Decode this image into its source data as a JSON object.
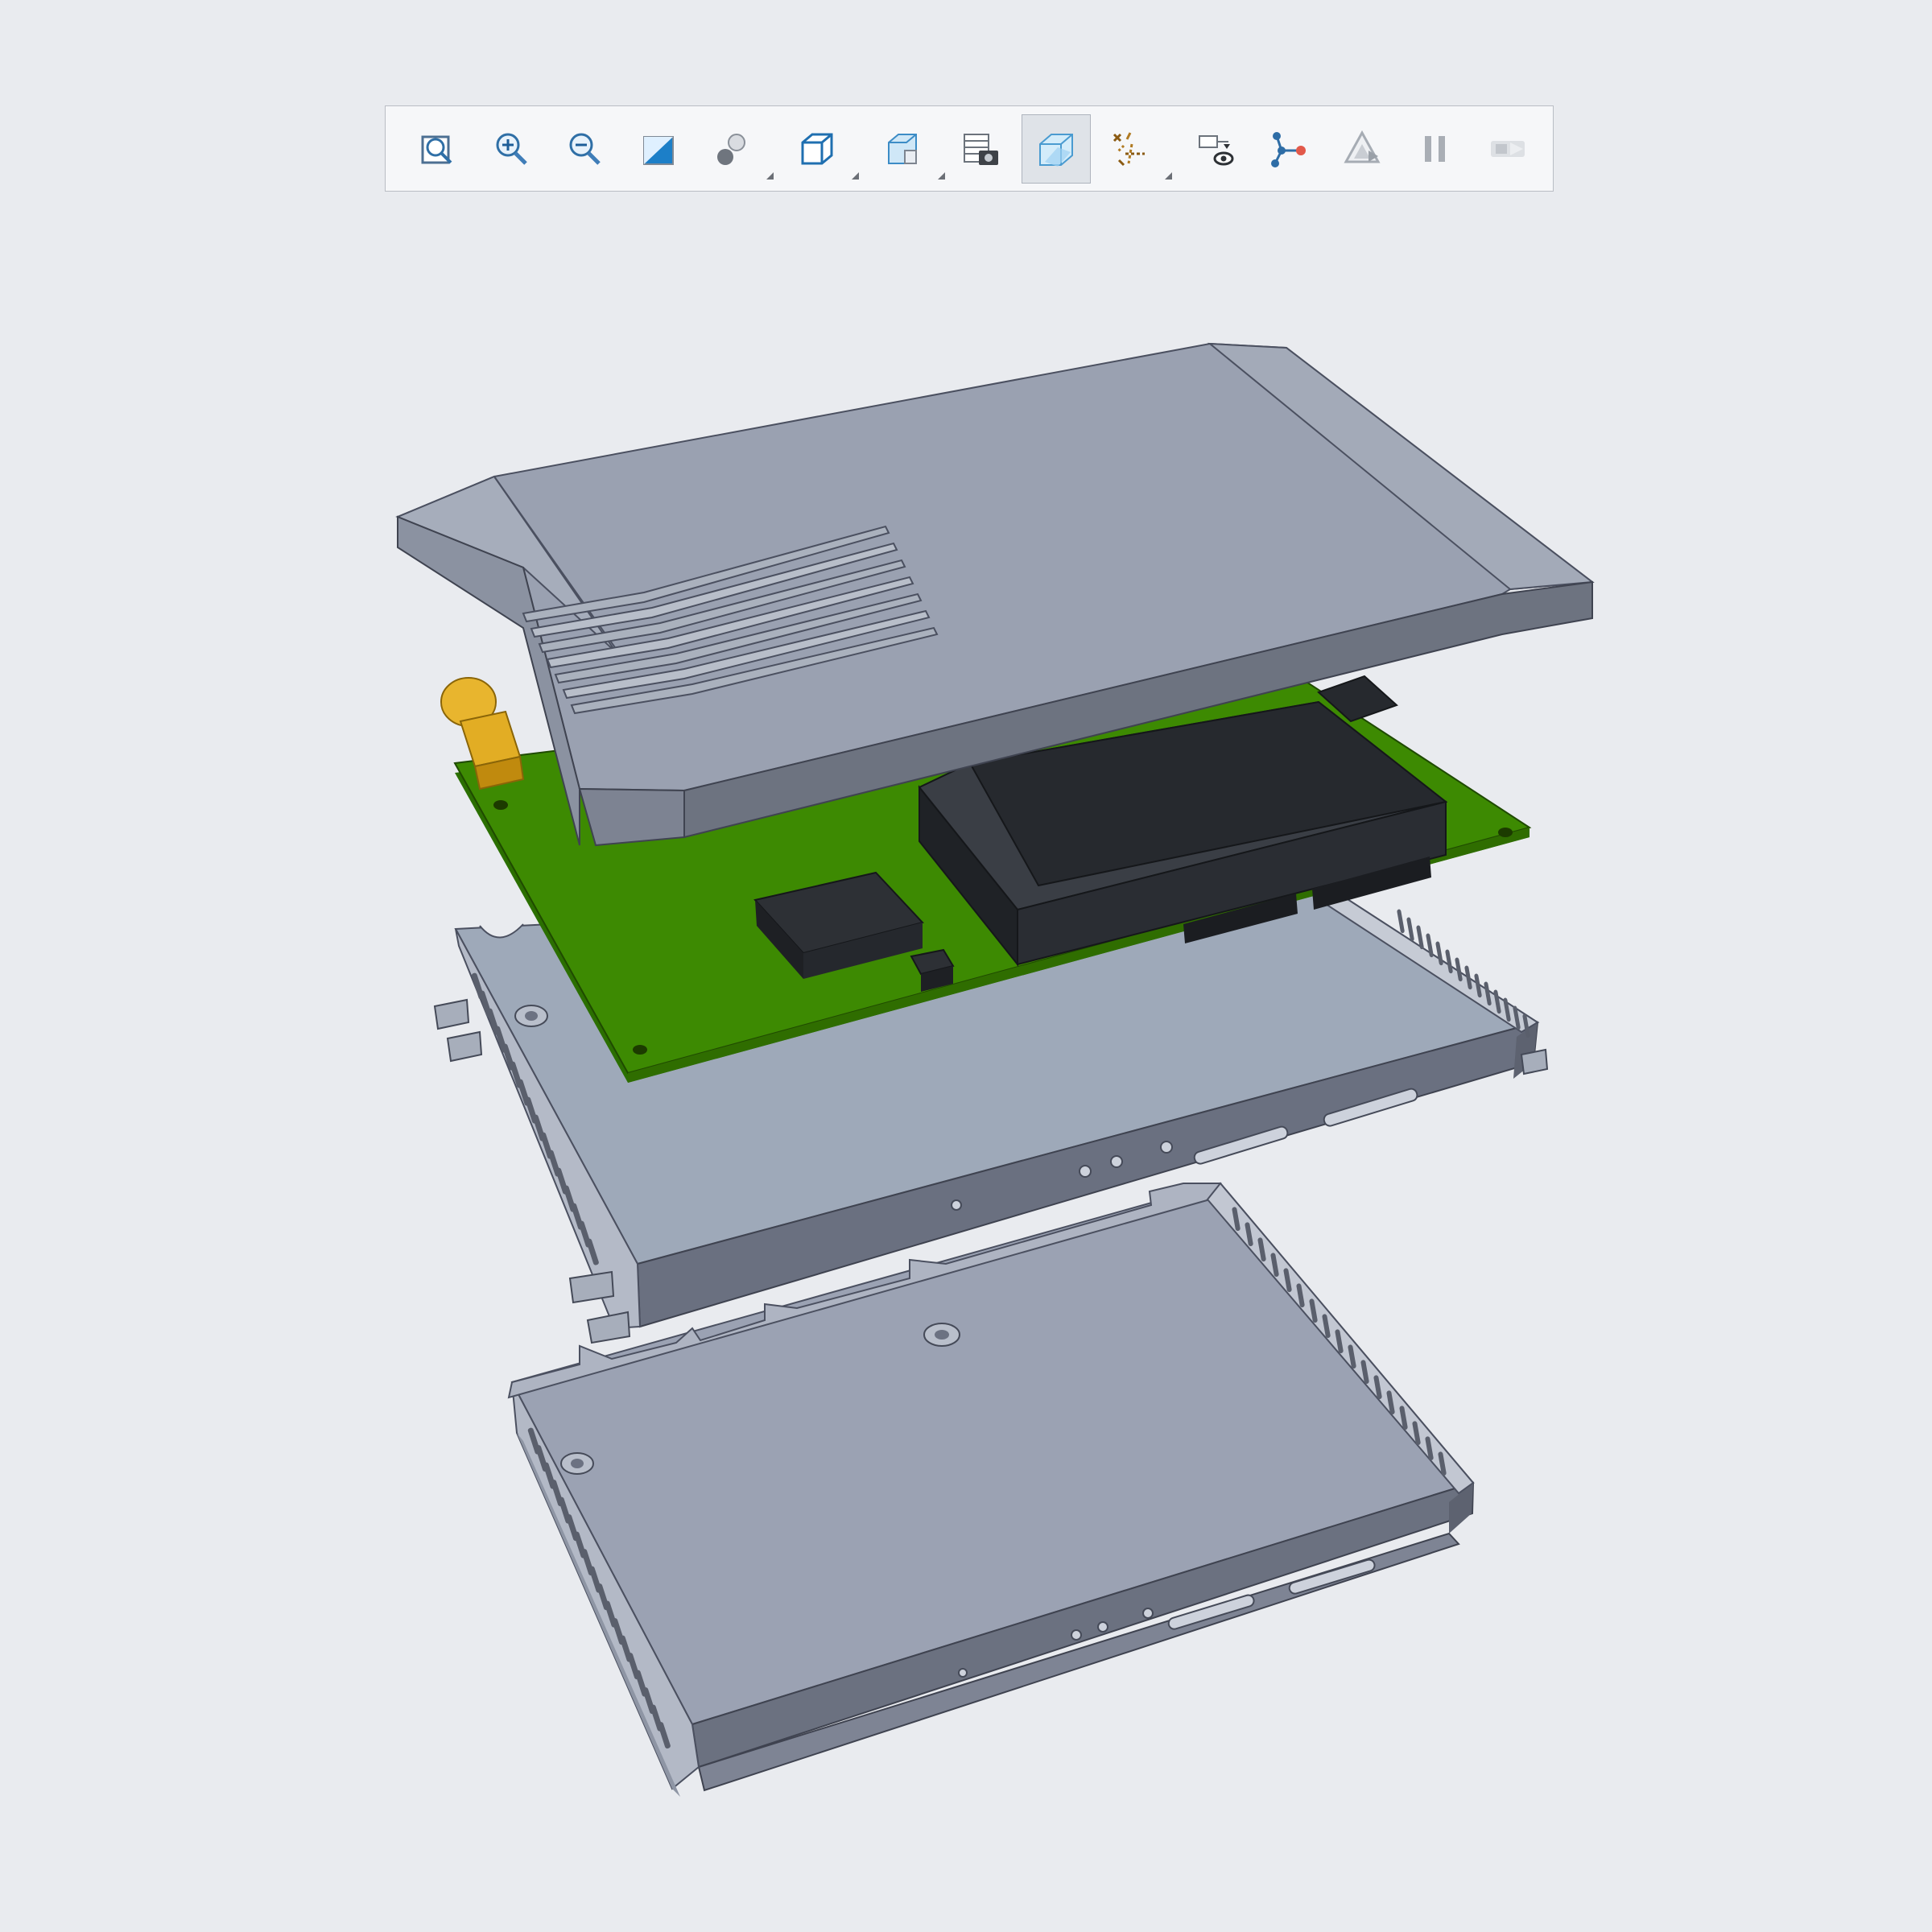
{
  "viewer": {
    "background": "#e9ebef",
    "active_tool": "view-manager",
    "model": {
      "type": "exploded-assembly",
      "parts": [
        "top-cover",
        "circuit-board",
        "middle-enclosure",
        "bottom-enclosure"
      ],
      "colors": {
        "housing": "#9aa1b1",
        "housing_dark": "#6d7380",
        "pcb": "#3d8a02",
        "component": "#26292e",
        "connector": "#e8b52e"
      }
    }
  },
  "toolbar": {
    "tools": [
      {
        "name": "refit-icon",
        "flyout": false,
        "active": false
      },
      {
        "name": "zoom-in-icon",
        "flyout": false,
        "active": false
      },
      {
        "name": "zoom-out-icon",
        "flyout": false,
        "active": false
      },
      {
        "name": "repaint-icon",
        "flyout": false,
        "active": false
      },
      {
        "name": "perspective-icon",
        "flyout": true,
        "active": false
      },
      {
        "name": "display-style-icon",
        "flyout": true,
        "active": false
      },
      {
        "name": "saved-orientations-icon",
        "flyout": true,
        "active": false
      },
      {
        "name": "view-manager-icon",
        "flyout": false,
        "active": false
      },
      {
        "name": "section-view-icon",
        "flyout": false,
        "active": true
      },
      {
        "name": "datum-display-icon",
        "flyout": true,
        "active": false
      },
      {
        "name": "annotation-display-icon",
        "flyout": false,
        "active": false
      },
      {
        "name": "spin-center-icon",
        "flyout": false,
        "active": false
      },
      {
        "name": "animation-icon",
        "flyout": false,
        "active": false
      },
      {
        "name": "pause-icon",
        "flyout": false,
        "active": false
      },
      {
        "name": "next-frame-icon",
        "flyout": false,
        "active": false
      }
    ]
  }
}
